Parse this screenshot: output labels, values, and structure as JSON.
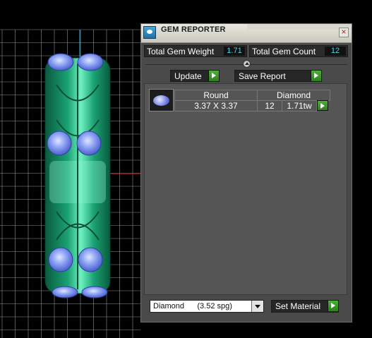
{
  "panel": {
    "title": "GEM REPORTER",
    "close_label": "×",
    "icons": {
      "app": "gem-reporter-icon",
      "close": "close-icon"
    },
    "total_gem_weight": {
      "label": "Total Gem Weight",
      "value": "1.71"
    },
    "total_gem_count": {
      "label": "Total Gem Count",
      "value": "12"
    },
    "buttons": {
      "update": "Update",
      "save_report": "Save Report"
    },
    "table": {
      "headers": {
        "shape": "Round",
        "material": "Diamond"
      },
      "row": {
        "size": "3.37 X 3.37",
        "count": "12",
        "weight": "1.71tw"
      }
    },
    "material_select": {
      "value": "Diamond      (3.52 spg)"
    },
    "set_material": "Set Material",
    "colors": {
      "accent_value": "#4fd6e6",
      "go_button": "#3f9a2d",
      "panel_bg": "#4a4a4a"
    }
  },
  "viewport": {
    "grid_color": "#8f8f8f",
    "axis_x_color": "#e02020",
    "axis_y_color": "#2aa6d6",
    "model_color": "#1ea57a",
    "gem_color": "#7f95f0"
  }
}
